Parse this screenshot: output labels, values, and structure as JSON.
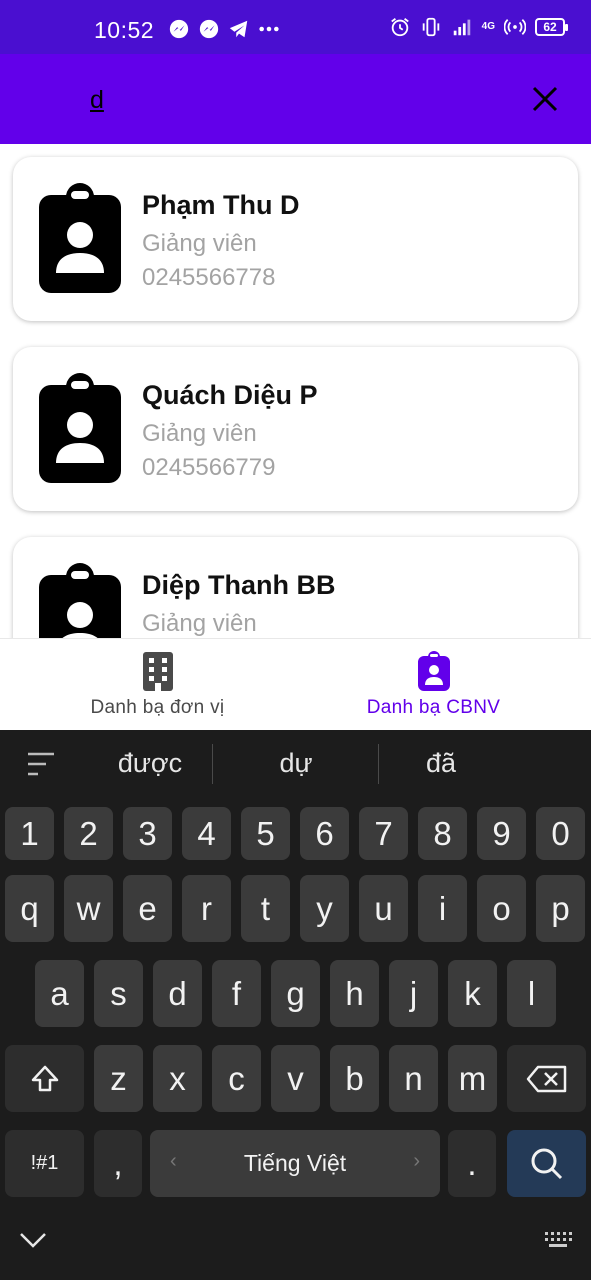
{
  "status_bar": {
    "time": "10:52",
    "battery": "62",
    "network": "4G"
  },
  "search": {
    "value": "d",
    "close_icon": "close-icon"
  },
  "contacts": [
    {
      "name": "Phạm Thu D",
      "role": "Giảng viên",
      "phone": "0245566778"
    },
    {
      "name": "Quách Diệu P",
      "role": "Giảng viên",
      "phone": "0245566779"
    },
    {
      "name": "Diệp Thanh BB",
      "role": "Giảng viên",
      "phone": ""
    }
  ],
  "bottom_nav": {
    "items": [
      {
        "label": "Danh bạ đơn vị",
        "icon": "building-icon",
        "active": false
      },
      {
        "label": "Danh bạ CBNV",
        "icon": "badge-icon",
        "active": true
      }
    ]
  },
  "keyboard": {
    "suggestions": [
      "được",
      "dự",
      "đã"
    ],
    "row_numbers": [
      "1",
      "2",
      "3",
      "4",
      "5",
      "6",
      "7",
      "8",
      "9",
      "0"
    ],
    "row_1": [
      "q",
      "w",
      "e",
      "r",
      "t",
      "y",
      "u",
      "i",
      "o",
      "p"
    ],
    "row_2": [
      "a",
      "s",
      "d",
      "f",
      "g",
      "h",
      "j",
      "k",
      "l"
    ],
    "row_3": [
      "z",
      "x",
      "c",
      "v",
      "b",
      "n",
      "m"
    ],
    "symbols_label": "!#1",
    "comma": ",",
    "space_label": "Tiếng Việt",
    "period": "."
  },
  "colors": {
    "status_bar": "#4a0fd0",
    "app_bar": "#6200ea",
    "accent": "#6200ea",
    "keyboard_bg": "#1c1c1c"
  }
}
